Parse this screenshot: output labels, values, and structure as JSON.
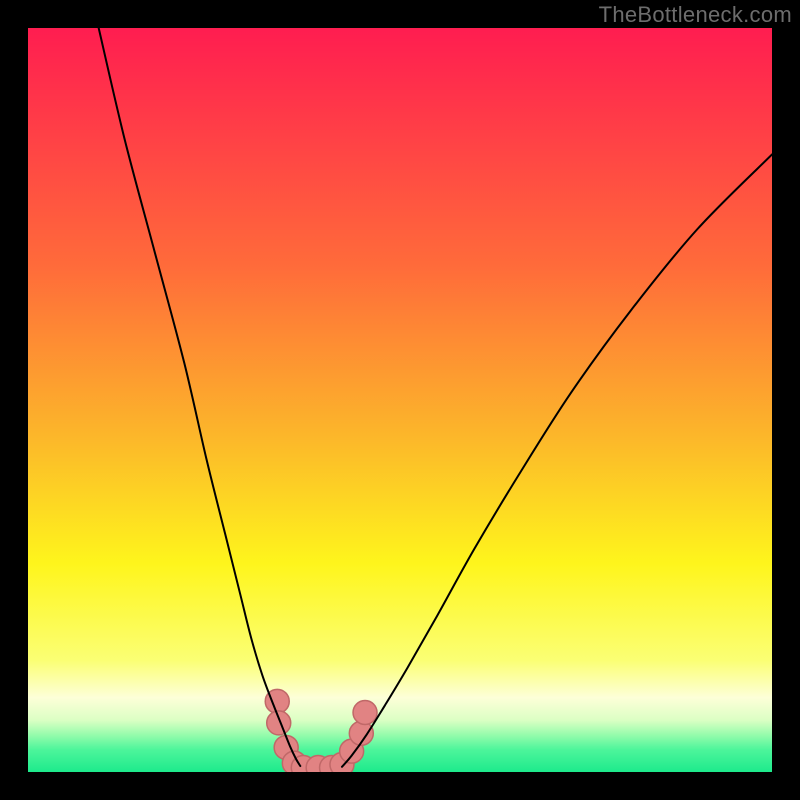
{
  "watermark": "TheBottleneck.com",
  "chart_data": {
    "type": "line",
    "title": "",
    "xlabel": "",
    "ylabel": "",
    "xlim": [
      0,
      100
    ],
    "ylim": [
      0,
      100
    ],
    "grid": false,
    "legend": false,
    "background_gradient_stops": [
      {
        "pct": 0,
        "color": "#ff1d50"
      },
      {
        "pct": 32,
        "color": "#ff6b3a"
      },
      {
        "pct": 55,
        "color": "#fcb72a"
      },
      {
        "pct": 72,
        "color": "#fef51c"
      },
      {
        "pct": 85,
        "color": "#fbff74"
      },
      {
        "pct": 90,
        "color": "#fdffd8"
      },
      {
        "pct": 93,
        "color": "#dcffc4"
      },
      {
        "pct": 95,
        "color": "#96fcac"
      },
      {
        "pct": 97,
        "color": "#4df59b"
      },
      {
        "pct": 100,
        "color": "#1dea8c"
      }
    ],
    "series": [
      {
        "name": "left-curve",
        "stroke": "#000000",
        "stroke_width": 2,
        "x": [
          9.5,
          13,
          17,
          21,
          24,
          26.5,
          28.5,
          30,
          31.5,
          33,
          34.2,
          35.2,
          36,
          36.6
        ],
        "y": [
          100,
          85,
          70,
          55,
          42,
          32,
          24,
          18,
          13,
          9,
          6,
          3.5,
          1.8,
          0.8
        ]
      },
      {
        "name": "right-curve",
        "stroke": "#000000",
        "stroke_width": 2,
        "x": [
          42.2,
          43.5,
          45.5,
          48,
          51,
          55,
          60,
          66,
          73,
          81,
          90,
          100
        ],
        "y": [
          0.7,
          2.2,
          5,
          9,
          14,
          21,
          30,
          40,
          51,
          62,
          73,
          83
        ]
      },
      {
        "name": "valley-band",
        "type": "scatter",
        "stroke": "#e18383",
        "marker_fill": "#e18383",
        "marker_stroke": "#c06868",
        "marker_radius": 12,
        "points": [
          {
            "x": 33.5,
            "y": 9.5
          },
          {
            "x": 33.7,
            "y": 6.6
          },
          {
            "x": 34.7,
            "y": 3.3
          },
          {
            "x": 35.8,
            "y": 1.2
          },
          {
            "x": 37.0,
            "y": 0.6
          },
          {
            "x": 39.0,
            "y": 0.6
          },
          {
            "x": 40.8,
            "y": 0.6
          },
          {
            "x": 42.2,
            "y": 1.0
          },
          {
            "x": 43.5,
            "y": 2.8
          },
          {
            "x": 44.8,
            "y": 5.2
          },
          {
            "x": 45.3,
            "y": 8.0
          }
        ]
      }
    ]
  }
}
